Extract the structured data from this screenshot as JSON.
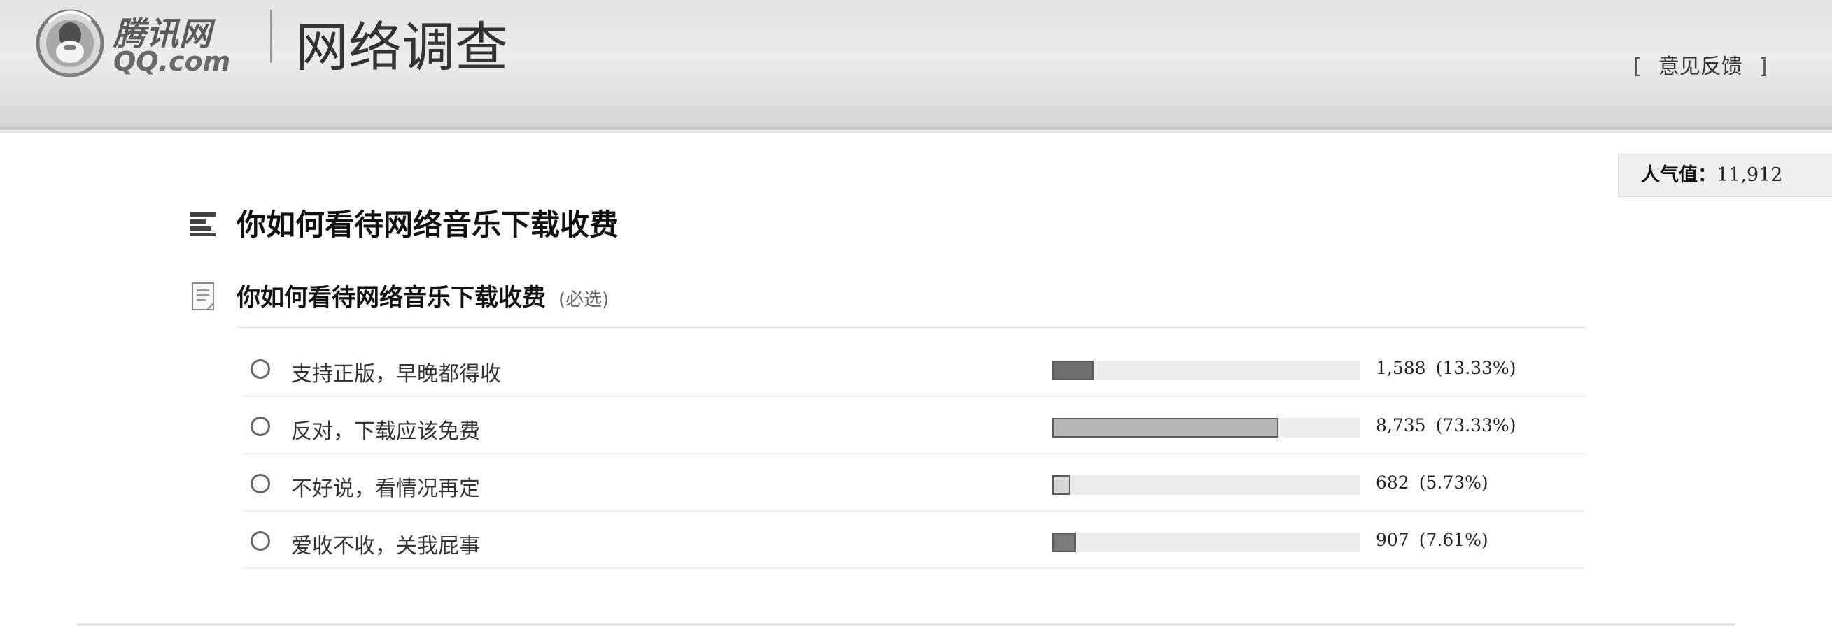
{
  "header": {
    "logo_text": "腾讯网",
    "logo_sub": "QQ.com",
    "page_heading": "网络调查",
    "feedback_open": "[",
    "feedback_label": "意见反馈",
    "feedback_close": "]"
  },
  "popularity": {
    "label": "人气值：",
    "value": "11,912"
  },
  "survey": {
    "title": "你如何看待网络音乐下载收费"
  },
  "question": {
    "text": "你如何看待网络音乐下载收费",
    "required": "(必选)",
    "options": [
      {
        "label": "支持正版，早晚都得收",
        "count": "1,588",
        "percent": "(13.33%)",
        "share": 0.1333,
        "bar_color": "#6e6e6e"
      },
      {
        "label": "反对，下载应该免费",
        "count": "8,735",
        "percent": "(73.33%)",
        "share": 0.7333,
        "bar_color": "#b8b8b8"
      },
      {
        "label": "不好说，看情况再定",
        "count": "682",
        "percent": "(5.73%)",
        "share": 0.0573,
        "bar_color": "#d6d6d6"
      },
      {
        "label": "爱收不收，关我屁事",
        "count": "907",
        "percent": "(7.61%)",
        "share": 0.0761,
        "bar_color": "#7a7a7a"
      }
    ]
  },
  "icons": {
    "logo": "qq-penguin-logo-icon",
    "title": "list-icon",
    "question": "document-icon"
  }
}
